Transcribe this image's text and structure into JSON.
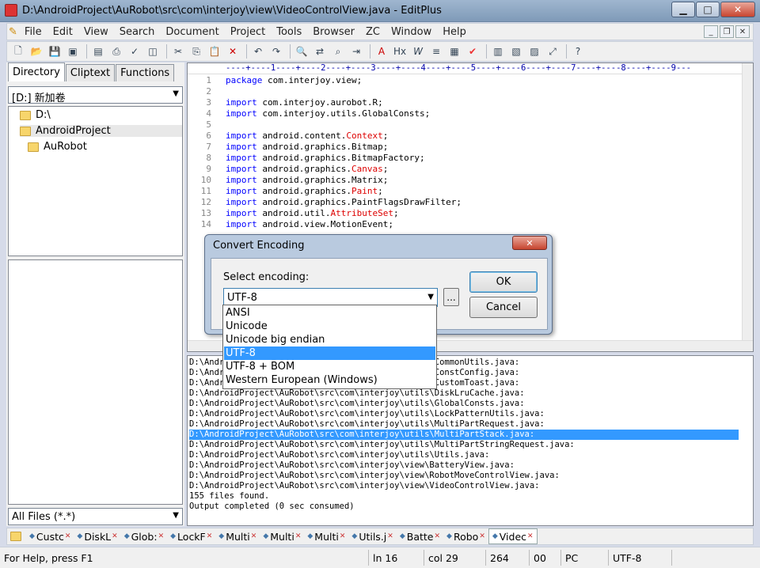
{
  "window": {
    "title": "D:\\AndroidProject\\AuRobot\\src\\com\\interjoy\\view\\VideoControlView.java - EditPlus"
  },
  "menu": [
    "File",
    "Edit",
    "View",
    "Search",
    "Document",
    "Project",
    "Tools",
    "Browser",
    "ZC",
    "Window",
    "Help"
  ],
  "left": {
    "tabs": [
      "Directory",
      "Cliptext",
      "Functions"
    ],
    "drive": "[D:] 新加卷",
    "tree": [
      "D:\\",
      "AndroidProject",
      "AuRobot"
    ],
    "filter": "All Files (*.*)"
  },
  "editor": {
    "ruler": "----+----1----+----2----+----3----+----4----+----5----+----6----+----7----+----8----+----9---",
    "lines": [
      {
        "n": "1",
        "kw": "package",
        "rest": " com.interjoy.view;",
        "cls": "",
        "end": ""
      },
      {
        "n": "2",
        "kw": "",
        "rest": "",
        "cls": "",
        "end": ""
      },
      {
        "n": "3",
        "kw": "import",
        "rest": " com.interjoy.aurobot.R;",
        "cls": "",
        "end": ""
      },
      {
        "n": "4",
        "kw": "import",
        "rest": " com.interjoy.utils.GlobalConsts;",
        "cls": "",
        "end": ""
      },
      {
        "n": "5",
        "kw": "",
        "rest": "",
        "cls": "",
        "end": ""
      },
      {
        "n": "6",
        "kw": "import",
        "rest": " android.content.",
        "cls": "Context",
        "end": ";"
      },
      {
        "n": "7",
        "kw": "import",
        "rest": " android.graphics.Bitmap;",
        "cls": "",
        "end": ""
      },
      {
        "n": "8",
        "kw": "import",
        "rest": " android.graphics.BitmapFactory;",
        "cls": "",
        "end": ""
      },
      {
        "n": "9",
        "kw": "import",
        "rest": " android.graphics.",
        "cls": "Canvas",
        "end": ";"
      },
      {
        "n": "10",
        "kw": "import",
        "rest": " android.graphics.Matrix;",
        "cls": "",
        "end": ""
      },
      {
        "n": "11",
        "kw": "import",
        "rest": " android.graphics.",
        "cls": "Paint",
        "end": ";"
      },
      {
        "n": "12",
        "kw": "import",
        "rest": " android.graphics.PaintFlagsDrawFilter;",
        "cls": "",
        "end": ""
      },
      {
        "n": "13",
        "kw": "import",
        "rest": " android.util.",
        "cls": "AttributeSet",
        "end": ";"
      },
      {
        "n": "14",
        "kw": "import",
        "rest": " android.view.MotionEvent;",
        "cls": "",
        "end": ""
      }
    ]
  },
  "output": {
    "lines": [
      "D:\\AndroidProject\\AuRobot\\src\\com\\interjoy\\utils\\CommonUtils.java:",
      "D:\\AndroidProject\\AuRobot\\src\\com\\interjoy\\utils\\ConstConfig.java:",
      "D:\\AndroidProject\\AuRobot\\src\\com\\interjoy\\utils\\CustomToast.java:",
      "D:\\AndroidProject\\AuRobot\\src\\com\\interjoy\\utils\\DiskLruCache.java:",
      "D:\\AndroidProject\\AuRobot\\src\\com\\interjoy\\utils\\GlobalConsts.java:",
      "D:\\AndroidProject\\AuRobot\\src\\com\\interjoy\\utils\\LockPatternUtils.java:",
      "D:\\AndroidProject\\AuRobot\\src\\com\\interjoy\\utils\\MultiPartRequest.java:",
      "D:\\AndroidProject\\AuRobot\\src\\com\\interjoy\\utils\\MultiPartStack.java:",
      "D:\\AndroidProject\\AuRobot\\src\\com\\interjoy\\utils\\MultiPartStringRequest.java:",
      "D:\\AndroidProject\\AuRobot\\src\\com\\interjoy\\utils\\Utils.java:",
      "D:\\AndroidProject\\AuRobot\\src\\com\\interjoy\\view\\BatteryView.java:",
      "D:\\AndroidProject\\AuRobot\\src\\com\\interjoy\\view\\RobotMoveControlView.java:",
      "D:\\AndroidProject\\AuRobot\\src\\com\\interjoy\\view\\VideoControlView.java:",
      "155 files found.",
      "Output completed (0 sec consumed)"
    ],
    "selected_index": 7
  },
  "doc_tabs": [
    "Custc",
    "DiskL",
    "Glob:",
    "LockF",
    "Multi",
    "Multi",
    "Multi",
    "Utils.j",
    "Batte",
    "Robo",
    "Videc"
  ],
  "status": {
    "help": "For Help, press F1",
    "line": "ln 16",
    "col": "col 29",
    "num": "264",
    "hex": "00",
    "mode": "PC",
    "encoding": "UTF-8"
  },
  "dialog": {
    "title": "Convert Encoding",
    "label": "Select encoding:",
    "selected": "UTF-8",
    "dots": "...",
    "ok": "OK",
    "cancel": "Cancel",
    "options": [
      "ANSI",
      "Unicode",
      "Unicode big endian",
      "UTF-8",
      "UTF-8 + BOM",
      "Western European (Windows)"
    ],
    "selected_option_index": 3
  }
}
